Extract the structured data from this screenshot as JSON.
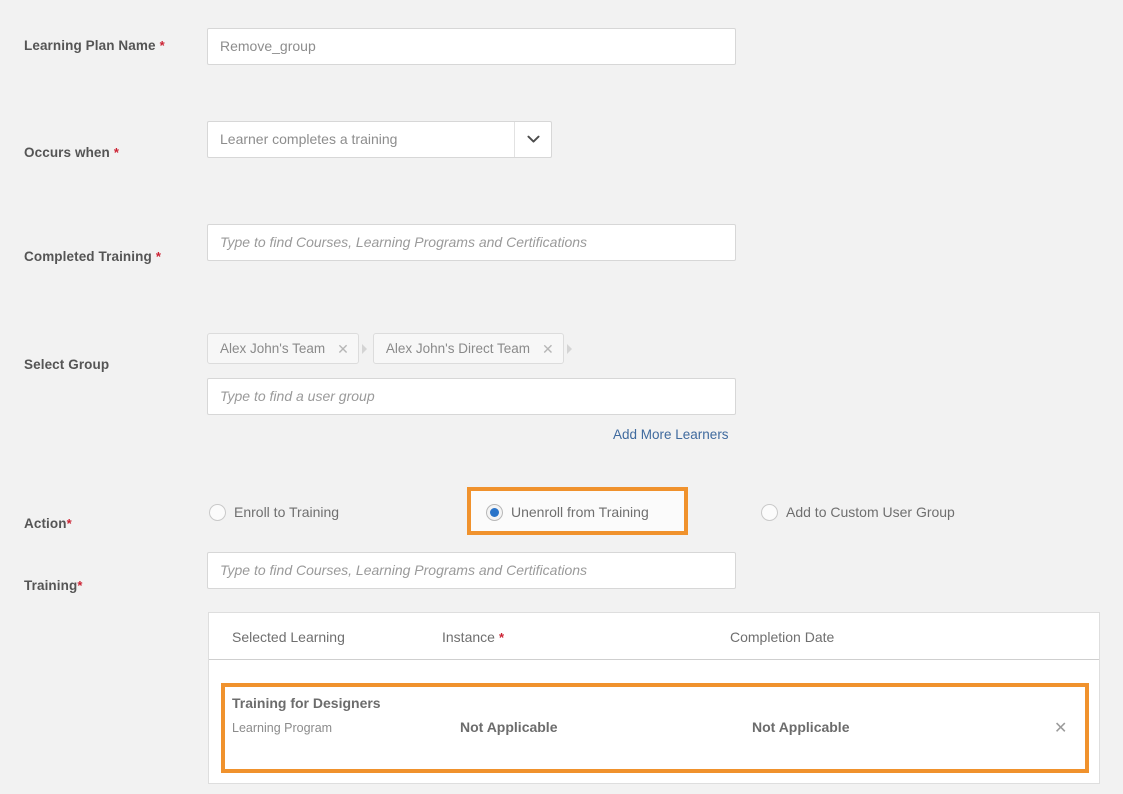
{
  "colors": {
    "page_bg": "#f2f2f2",
    "highlight_orange": "#f0922d",
    "required_red": "#cc2233",
    "link_blue": "#3f6a9e",
    "radio_selected_blue": "#2a74c9",
    "label_grey": "#555555",
    "input_border": "#d7d7d7"
  },
  "fields": {
    "learning_plan_name": {
      "label": "Learning Plan Name",
      "required": true,
      "value": "Remove_group"
    },
    "occurs_when": {
      "label": "Occurs when",
      "required": true,
      "selected": "Learner completes a training",
      "chevron_icon": "chevron-down-icon"
    },
    "completed_training": {
      "label": "Completed Training",
      "required": true,
      "placeholder": "Type to find Courses, Learning Programs and Certifications",
      "value": ""
    },
    "select_group": {
      "label": "Select Group",
      "required": false,
      "placeholder": "Type to find a user group",
      "value": "",
      "chips": [
        {
          "label": "Alex John's Team",
          "remove_icon": "close-icon"
        },
        {
          "label": "Alex John's Direct Team",
          "remove_icon": "close-icon"
        }
      ],
      "add_more_link": "Add More Learners"
    },
    "action": {
      "label": "Action",
      "required": true,
      "options": [
        {
          "label": "Enroll to Training",
          "selected": false,
          "highlighted": false
        },
        {
          "label": "Unenroll from Training",
          "selected": true,
          "highlighted": true
        },
        {
          "label": "Add to Custom User Group",
          "selected": false,
          "highlighted": false
        }
      ]
    },
    "training": {
      "label": "Training",
      "required": true,
      "placeholder": "Type to find Courses, Learning Programs and Certifications",
      "value": ""
    }
  },
  "selected_learning_table": {
    "columns": [
      {
        "label": "Selected Learning",
        "required": false
      },
      {
        "label": "Instance",
        "required": true
      },
      {
        "label": "Completion Date",
        "required": false
      }
    ],
    "rows": [
      {
        "title": "Training for Designers",
        "subtitle": "Learning Program",
        "instance": "Not Applicable",
        "completion_date": "Not Applicable",
        "remove_icon": "close-icon",
        "highlighted": true
      }
    ]
  }
}
